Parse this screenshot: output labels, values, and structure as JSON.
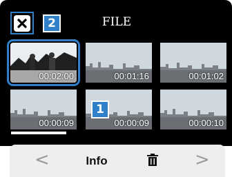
{
  "header": {
    "title": "FILE",
    "close_icon": "close-icon",
    "badge_close": "2"
  },
  "grid": {
    "badge_selected": "1",
    "thumbnails": [
      {
        "time": "00:02:00",
        "selected": true
      },
      {
        "time": "00:01:16",
        "selected": false
      },
      {
        "time": "00:01:02",
        "selected": false
      },
      {
        "time": "00:00:09",
        "selected": false
      },
      {
        "time": "00:00:09",
        "selected": false
      },
      {
        "time": "00:00:10",
        "selected": false
      }
    ]
  },
  "footer": {
    "prev_icon": "chevron-left-icon",
    "info_label": "Info",
    "delete_icon": "trash-icon",
    "next_icon": "chevron-right-icon"
  },
  "colors": {
    "accent": "#2f80c8",
    "background": "#000000"
  }
}
